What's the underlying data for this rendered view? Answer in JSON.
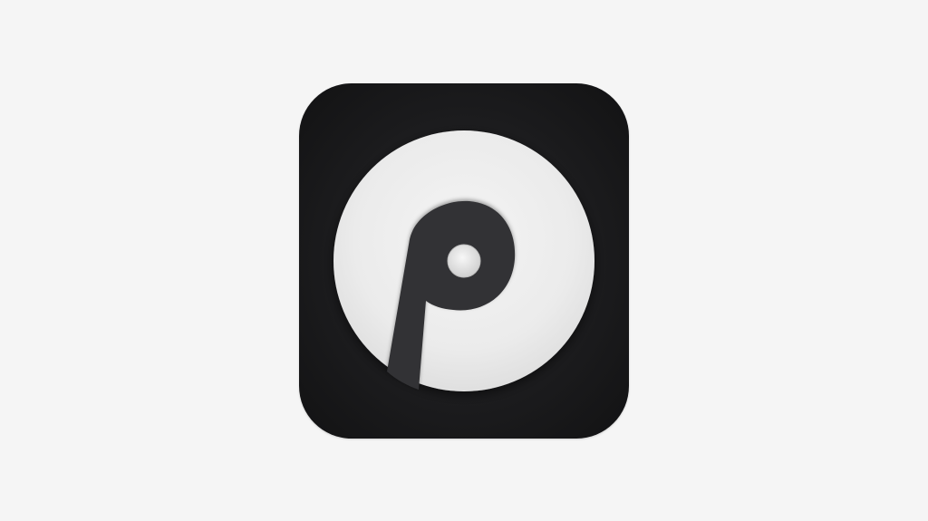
{
  "app_icon": {
    "icon_name": "vinyl-disc-letter-p-icon",
    "colors": {
      "page_background": "#f5f5f5",
      "tile": "#1c1c1e",
      "disc": "#ececec",
      "glyph": "#333335"
    }
  }
}
